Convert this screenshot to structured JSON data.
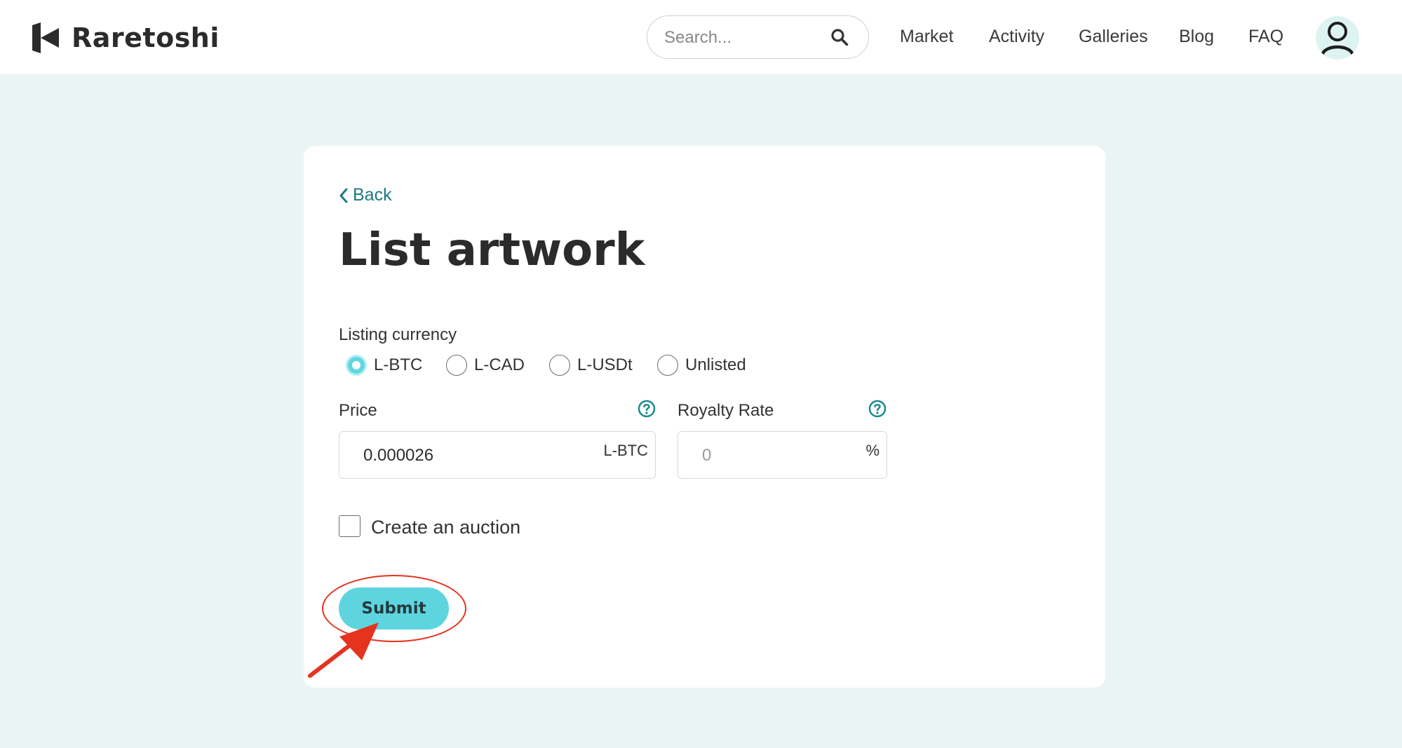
{
  "header": {
    "brand_name": "Raretoshi",
    "search": {
      "placeholder": "Search..."
    },
    "nav": [
      {
        "label": "Market"
      },
      {
        "label": "Activity"
      },
      {
        "label": "Galleries"
      },
      {
        "label": "Blog"
      },
      {
        "label": "FAQ"
      }
    ]
  },
  "form": {
    "back_label": "Back",
    "title": "List artwork",
    "currency_label": "Listing currency",
    "currency_options": [
      {
        "label": "L-BTC",
        "selected": true
      },
      {
        "label": "L-CAD",
        "selected": false
      },
      {
        "label": "L-USDt",
        "selected": false
      },
      {
        "label": "Unlisted",
        "selected": false
      }
    ],
    "price": {
      "label": "Price",
      "value": "0.000026",
      "unit": "L-BTC"
    },
    "royalty": {
      "label": "Royalty Rate",
      "placeholder": "0",
      "unit": "%"
    },
    "auction": {
      "label": "Create an auction",
      "checked": false
    },
    "submit_label": "Submit"
  },
  "colors": {
    "accent": "#5ED5DE",
    "link": "#1B7A80",
    "page_background": "#EBF4F4",
    "annotation": "#E5331F"
  },
  "icons": {
    "logo": "raretoshi-logo-icon",
    "search": "search-icon",
    "avatar": "user-avatar-icon",
    "back": "chevron-left-icon",
    "help": "question-circle-icon"
  }
}
